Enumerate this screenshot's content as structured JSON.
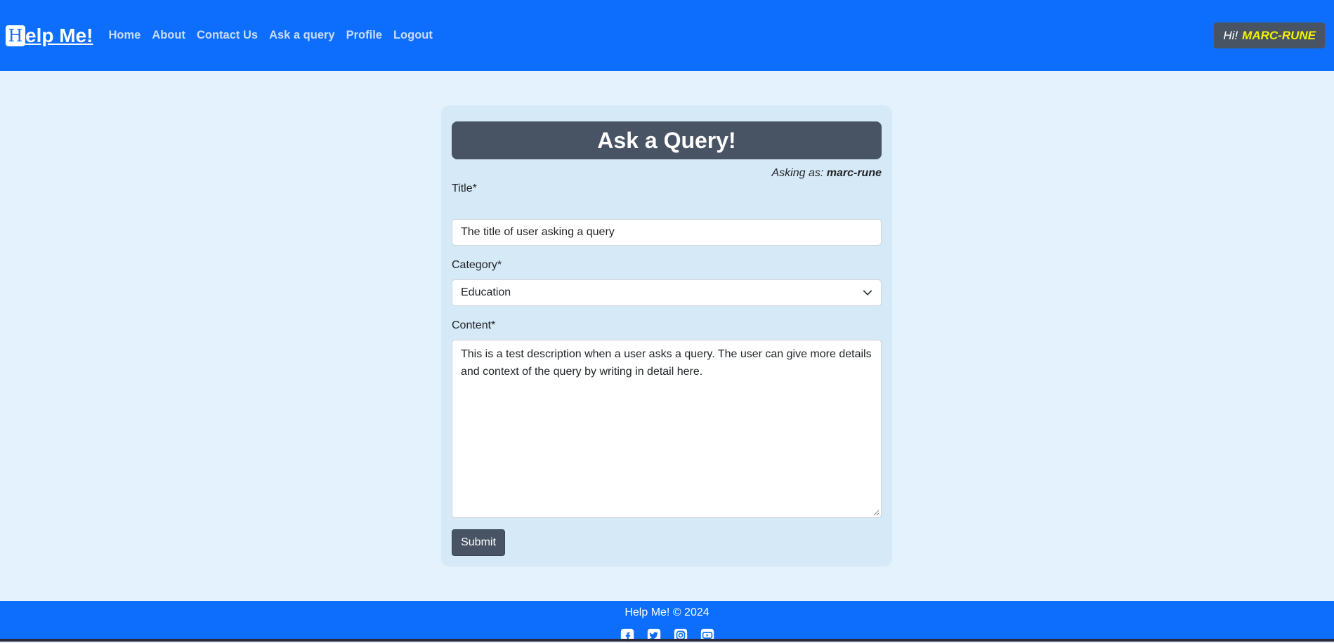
{
  "navbar": {
    "brand_initial": "H",
    "brand_rest": "elp Me!",
    "links": [
      "Home",
      "About",
      "Contact Us",
      "Ask a query",
      "Profile",
      "Logout"
    ],
    "greeting_hi": "Hi!",
    "greeting_user": "MARC-RUNE"
  },
  "form": {
    "heading": "Ask a Query!",
    "asking_as_label": "Asking as:",
    "asking_as_user": "marc-rune",
    "title_label": "Title*",
    "title_value": "The title of user asking a query",
    "category_label": "Category*",
    "category_value": "Education",
    "content_label": "Content*",
    "content_value": "This is a test description when a user asks a query. The user can give more details and context of the query by writing in detail here.",
    "submit_label": "Submit"
  },
  "footer": {
    "copyright": "Help Me! © 2024",
    "social_icons": [
      "facebook-icon",
      "twitter-icon",
      "instagram-icon",
      "youtube-icon"
    ]
  },
  "colors": {
    "navbar": "#0d6efd",
    "page_bg": "#e3f2fc",
    "card_bg": "#d6e9f6",
    "dark_slate": "#485464",
    "username_yellow": "#f5f100"
  }
}
